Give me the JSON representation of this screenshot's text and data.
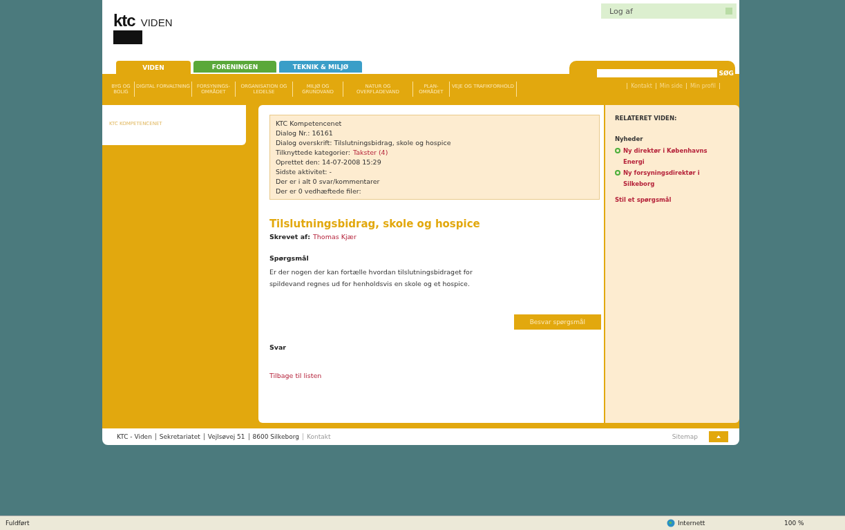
{
  "header": {
    "logo": "ktc",
    "brand": "VIDEN",
    "logout": "Log af"
  },
  "tabs": [
    {
      "label": "VIDEN",
      "selected": true,
      "color": "#e2a80e"
    },
    {
      "label": "FORENINGEN",
      "selected": false,
      "color": "#5aa83a"
    },
    {
      "label": "TEKNIK & MILJØ",
      "selected": false,
      "color": "#3a9ec8"
    }
  ],
  "search": {
    "button": "SØG"
  },
  "subnav": [
    "BYG OG BOLIG",
    "DIGITAL FORVALTNING",
    "FORSYNINGS-OMRÅDET",
    "ORGANISATION OG LEDELSE",
    "MILJØ OG GRUNDVAND",
    "NATUR OG OVERFLADEVAND",
    "PLAN-OMRÅDET",
    "VEJE OG TRAFIKFORHOLD"
  ],
  "user_links": [
    "Kontakt",
    "Min side",
    "Min profil"
  ],
  "sidebar": {
    "items": [
      "KTC KOMPETENCENET"
    ]
  },
  "info_box": [
    {
      "text": "KTC Kompetencenet"
    },
    {
      "text": "Dialog Nr.: 16161"
    },
    {
      "text": "Dialog overskrift: Tilslutningsbidrag, skole og hospice"
    },
    {
      "text": "Tilknyttede kategorier:",
      "link": "Takster (4)"
    },
    {
      "text": "Oprettet den: 14-07-2008 15:29"
    },
    {
      "text": "Sidste aktivitet: -"
    },
    {
      "text": "Der er i alt 0 svar/kommentarer"
    },
    {
      "text": "Der er 0 vedhæftede filer:"
    }
  ],
  "question": {
    "title": "Tilslutningsbidrag, skole og hospice",
    "author_label": "Skrevet af:",
    "author": "Thomas Kjær",
    "heading": "Spørgsmål",
    "body": "Er der nogen der kan fortælle hvordan tilslutningsbidraget for spildevand regnes ud for henholdsvis en skole og et hospice.",
    "answer_button": "Besvar spørgsmål",
    "answers_heading": "Svar",
    "back_link": "Tilbage til listen"
  },
  "related": {
    "title": "RELATERET VIDEN:",
    "section": "Nyheder",
    "news": [
      "Ny direktør i Københavns Energi",
      "Ny forsyningsdirektør i Silkeborg"
    ],
    "ask_link": "Stil et spørgsmål"
  },
  "footer": {
    "items": [
      "KTC - Viden",
      "Sekretariatet",
      "Vejlsøvej 51",
      "8600 Silkeborg"
    ],
    "contact": "Kontakt",
    "sitemap": "Sitemap"
  },
  "status_bar": {
    "status": "Fuldført",
    "zone": "Internett",
    "zoom": "100 %"
  }
}
